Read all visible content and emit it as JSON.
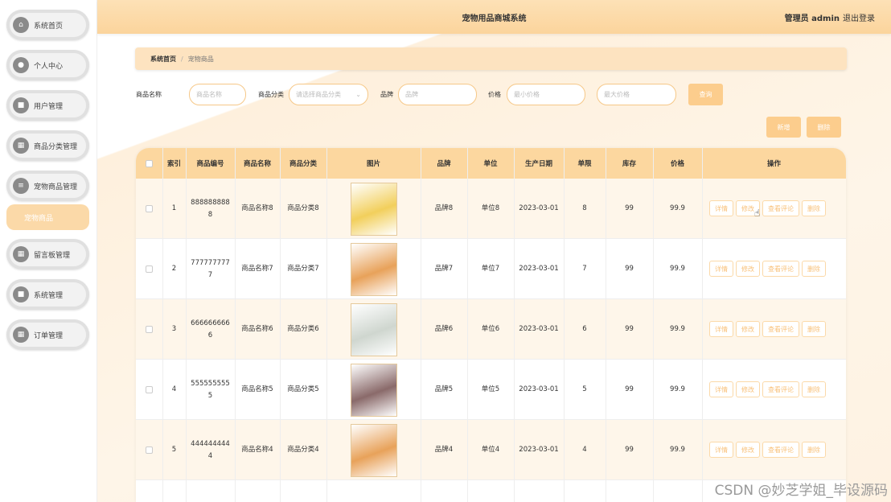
{
  "app": {
    "title": "宠物用品商城系统",
    "user": "管理员 admin",
    "logout": "退出登录"
  },
  "sidebar": {
    "items": [
      {
        "label": "系统首页",
        "icon": "home-icon"
      },
      {
        "label": "个人中心",
        "icon": "user-icon"
      },
      {
        "label": "用户管理",
        "icon": "users-icon"
      },
      {
        "label": "商品分类管理",
        "icon": "grid-icon"
      },
      {
        "label": "宠物商品管理",
        "icon": "list-icon"
      },
      {
        "label": "留言板管理",
        "icon": "grid-icon"
      },
      {
        "label": "系统管理",
        "icon": "settings-icon"
      },
      {
        "label": "订单管理",
        "icon": "grid-icon"
      }
    ],
    "submenu": {
      "label": "宠物商品"
    }
  },
  "breadcrumb": {
    "home": "系统首页",
    "sep": "/",
    "current": "宠物商品"
  },
  "filters": {
    "name_label": "商品名称",
    "name_placeholder": "商品名称",
    "category_label": "商品分类",
    "category_placeholder": "请选择商品分类",
    "brand_label": "品牌",
    "brand_placeholder": "品牌",
    "price_label": "价格",
    "price_min_placeholder": "最小价格",
    "price_max_placeholder": "最大价格",
    "search_btn": "查询"
  },
  "actions": {
    "add": "新增",
    "delete": "删除"
  },
  "table": {
    "headers": [
      "索引",
      "商品编号",
      "商品名称",
      "商品分类",
      "图片",
      "品牌",
      "单位",
      "生产日期",
      "单限",
      "库存",
      "价格",
      "操作"
    ],
    "row_buttons": {
      "detail": "详情",
      "edit": "修改",
      "reviews": "查看评论",
      "delete": "删除"
    },
    "rows": [
      {
        "idx": "1",
        "code": "888888888\n8",
        "name": "商品名称8",
        "cat": "商品分类8",
        "brand": "品牌8",
        "unit": "单位8",
        "date": "2023-03-01",
        "limit": "8",
        "stock": "99",
        "price": "99.9",
        "thumb_color": "#f2cf5c"
      },
      {
        "idx": "2",
        "code": "777777777\n7",
        "name": "商品名称7",
        "cat": "商品分类7",
        "brand": "品牌7",
        "unit": "单位7",
        "date": "2023-03-01",
        "limit": "7",
        "stock": "99",
        "price": "99.9",
        "thumb_color": "#e8a25a"
      },
      {
        "idx": "3",
        "code": "666666666\n6",
        "name": "商品名称6",
        "cat": "商品分类6",
        "brand": "品牌6",
        "unit": "单位6",
        "date": "2023-03-01",
        "limit": "6",
        "stock": "99",
        "price": "99.9",
        "thumb_color": "#cfd6cf"
      },
      {
        "idx": "4",
        "code": "555555555\n5",
        "name": "商品名称5",
        "cat": "商品分类5",
        "brand": "品牌5",
        "unit": "单位5",
        "date": "2023-03-01",
        "limit": "5",
        "stock": "99",
        "price": "99.9",
        "thumb_color": "#8a6a6a"
      },
      {
        "idx": "5",
        "code": "444444444\n4",
        "name": "商品名称4",
        "cat": "商品分类4",
        "brand": "品牌4",
        "unit": "单位4",
        "date": "2023-03-01",
        "limit": "4",
        "stock": "99",
        "price": "99.9",
        "thumb_color": "#e8a25a"
      }
    ]
  },
  "watermark": "CSDN @妙芝学姐_毕设源码"
}
